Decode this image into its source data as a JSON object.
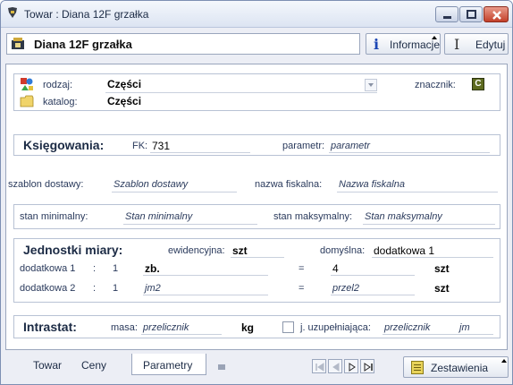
{
  "window": {
    "title": "Towar : Diana 12F grzałka"
  },
  "toolbar": {
    "item_name": "Diana 12F grzałka",
    "info_label": "Informacje",
    "edit_label": "Edytuj"
  },
  "classification": {
    "rodzaj_label": "rodzaj:",
    "rodzaj_value": "Części",
    "znacznik_label": "znacznik:",
    "znacznik_value": "C",
    "katalog_label": "katalog:",
    "katalog_value": "Części"
  },
  "accounting": {
    "heading": "Księgowania:",
    "fk_label": "FK:",
    "fk_value": "731",
    "parametr_label": "parametr:",
    "parametr_value": "parametr"
  },
  "delivery": {
    "szablon_label": "szablon dostawy:",
    "szablon_value": "Szablon dostawy",
    "fiscal_label": "nazwa fiskalna:",
    "fiscal_value": "Nazwa fiskalna"
  },
  "stock": {
    "min_label": "stan minimalny:",
    "min_value": "Stan minimalny",
    "max_label": "stan maksymalny:",
    "max_value": "Stan maksymalny"
  },
  "units": {
    "heading": "Jednostki miary:",
    "ewid_label": "ewidencyjna:",
    "ewid_value": "szt",
    "default_label": "domyślna:",
    "default_value": "dodatkowa 1",
    "rows": [
      {
        "label": "dodatkowa 1",
        "colon": ":",
        "qty": "1",
        "unit": "zb.",
        "eq": "=",
        "factor": "4",
        "base": "szt"
      },
      {
        "label": "dodatkowa 2",
        "colon": ":",
        "qty": "1",
        "unit": "jm2",
        "eq": "=",
        "factor": "przel2",
        "base": "szt"
      }
    ]
  },
  "intrastat": {
    "heading": "Intrastat:",
    "masa_label": "masa:",
    "masa_value": "przelicznik",
    "masa_unit": "kg",
    "supp_label": "j. uzupełniająca:",
    "supp_value": "przelicznik",
    "supp_unit": "jm"
  },
  "tabs": [
    {
      "label": "Towar",
      "active": false
    },
    {
      "label": "Ceny",
      "active": false
    },
    {
      "label": "Parametry",
      "active": true
    }
  ],
  "footer": {
    "zestawienia_label": "Zestawienia"
  },
  "colors": {
    "accent": "#1b46b4",
    "window_bg": "#eceef5",
    "border": "#9aa6bd"
  }
}
